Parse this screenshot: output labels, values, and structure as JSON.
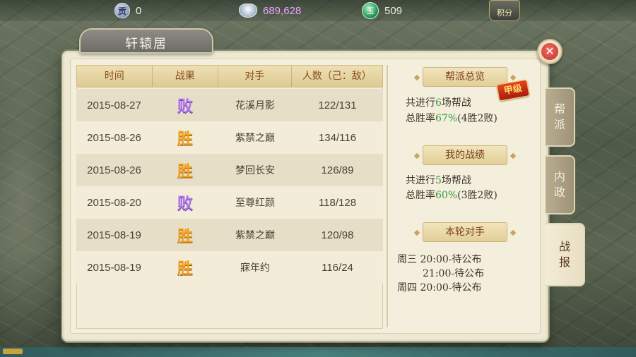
{
  "resources": {
    "contrib_icon_char": "贡",
    "contrib": "0",
    "silver": "689,628",
    "jade_icon_char": "玉",
    "jade": "509",
    "points_label": "积分"
  },
  "title": "轩辕居",
  "table": {
    "headers": [
      "时间",
      "战果",
      "对手",
      "人数（己：敌）"
    ],
    "rows": [
      {
        "date": "2015-08-27",
        "result": "败",
        "opponent": "花溪月影",
        "count": "122/131"
      },
      {
        "date": "2015-08-26",
        "result": "胜",
        "opponent": "紫禁之巅",
        "count": "134/116"
      },
      {
        "date": "2015-08-26",
        "result": "胜",
        "opponent": "梦回长安",
        "count": "126/89"
      },
      {
        "date": "2015-08-20",
        "result": "败",
        "opponent": "至尊红颜",
        "count": "118/128"
      },
      {
        "date": "2015-08-19",
        "result": "胜",
        "opponent": "紫禁之巅",
        "count": "120/98"
      },
      {
        "date": "2015-08-19",
        "result": "胜",
        "opponent": "寐年约",
        "count": "116/24"
      }
    ]
  },
  "overview": {
    "title": "帮派总览",
    "grade": "甲级",
    "line1_pre": "共进行",
    "line1_num": "6",
    "line1_post": "场帮战",
    "line2_pre": "总胜率",
    "line2_rate": "67%",
    "line2_post": "(4胜2败)"
  },
  "mine": {
    "title": "我的战绩",
    "line1_pre": "共进行",
    "line1_num": "5",
    "line1_post": "场帮战",
    "line2_pre": "总胜率",
    "line2_rate": "60%",
    "line2_post": "(3胜2败)"
  },
  "opponents": {
    "title": "本轮对手",
    "lines": [
      "周三 20:00-待公布",
      "21:00-待公布",
      "周四 20:00-待公布"
    ]
  },
  "tabs": [
    {
      "label_top": "帮",
      "label_bottom": "派"
    },
    {
      "label_top": "内",
      "label_bottom": "政"
    },
    {
      "label_top": "战",
      "label_bottom": "报"
    }
  ],
  "close_label": "✕",
  "colors": {
    "win": "#f0a226",
    "lose": "#b07ae6",
    "highlight": "#2e9b3d"
  }
}
